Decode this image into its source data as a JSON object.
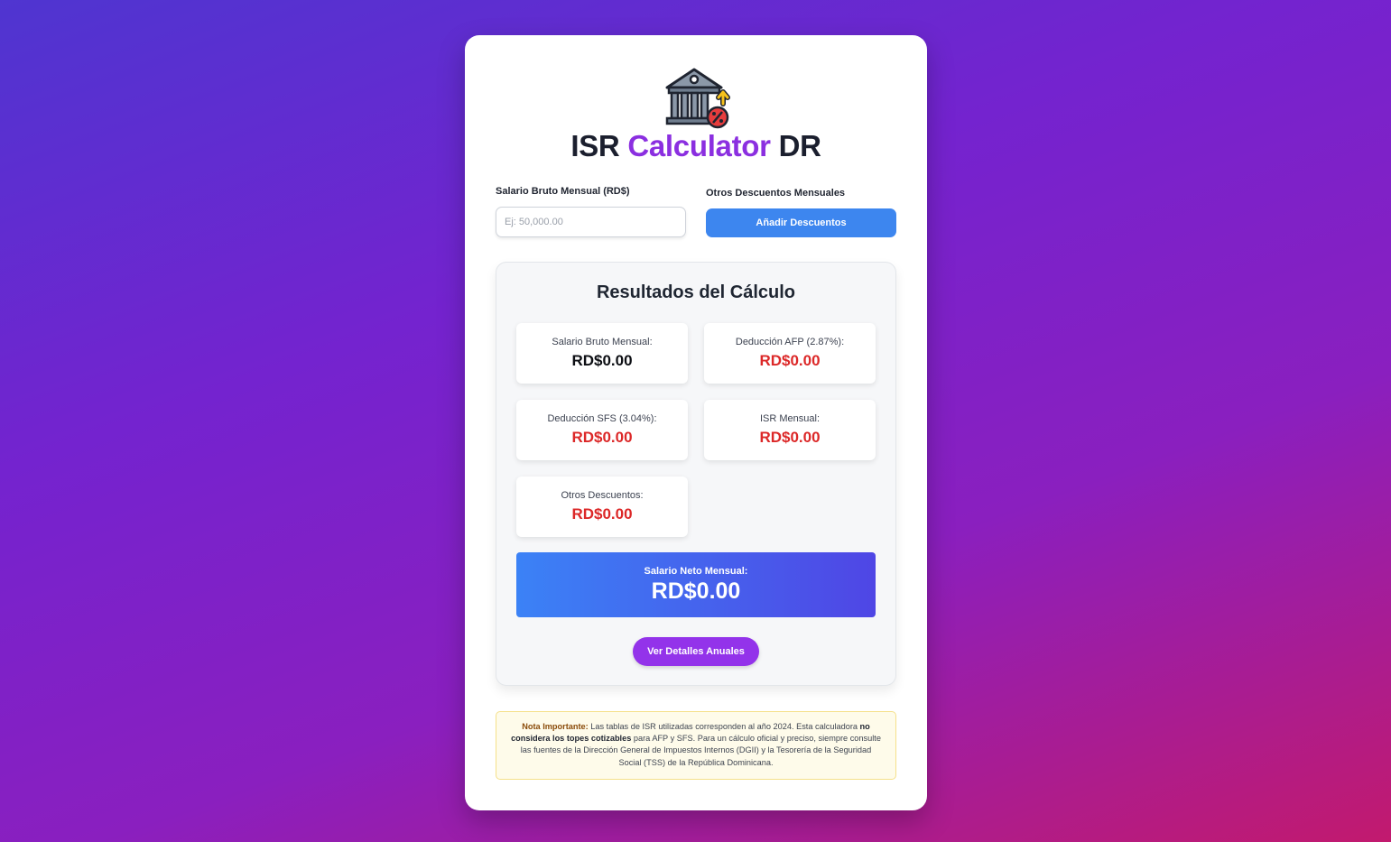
{
  "header": {
    "logo_icon": "bank-percent-icon",
    "title_part1": "ISR",
    "title_part2": "Calculator",
    "title_part3": "DR",
    "accent_color": "#8b2fe0"
  },
  "form": {
    "salary_label": "Salario Bruto Mensual (RD$)",
    "salary_placeholder": "Ej: 50,000.00",
    "salary_value": "",
    "other_label": "Otros Descuentos Mensuales",
    "add_button": "Añadir Descuentos"
  },
  "results": {
    "title": "Resultados del Cálculo",
    "items": [
      {
        "label": "Salario Bruto Mensual:",
        "value": "RD$0.00"
      },
      {
        "label": "Deducción AFP (2.87%):",
        "value": "RD$0.00"
      },
      {
        "label": "Deducción SFS (3.04%):",
        "value": "RD$0.00"
      },
      {
        "label": "ISR Mensual:",
        "value": "RD$0.00"
      },
      {
        "label": "Otros Descuentos:",
        "value": "RD$0.00"
      }
    ],
    "net_label": "Salario Neto Mensual:",
    "net_value": "RD$0.00",
    "annual_button": "Ver Detalles Anuales"
  },
  "note": {
    "prefix": "Nota Importante:",
    "text1": " Las tablas de ISR utilizadas corresponden al año 2024. Esta calculadora ",
    "bold": "no considera los topes cotizables",
    "text2": " para AFP y SFS. Para un cálculo oficial y preciso, siempre consulte las fuentes de la Dirección General de Impuestos Internos (DGII) y la Tesorería de la Seguridad Social (TSS) de la República Dominicana."
  },
  "colors": {
    "primary_blue": "#3d86ef",
    "purple": "#9333ea",
    "negative_red": "#dc2828"
  }
}
